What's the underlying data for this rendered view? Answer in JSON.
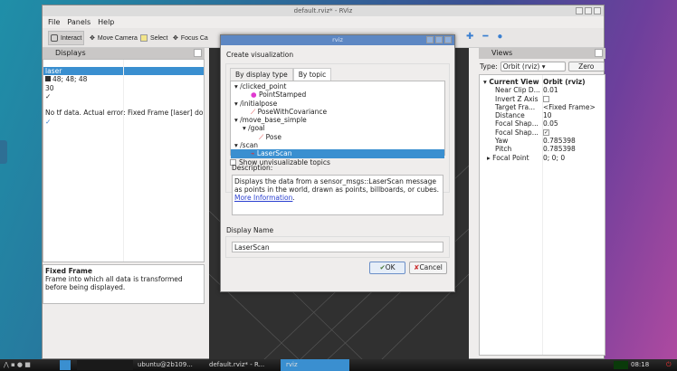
{
  "window": {
    "title": "default.rviz* - RViz"
  },
  "menu": [
    "File",
    "Panels",
    "Help"
  ],
  "toolbar": {
    "interact": "Interact",
    "move_camera": "Move Camera",
    "select": "Select",
    "focus_camera": "Focus Ca"
  },
  "displays": {
    "title": "Displays",
    "rows": [
      "laser",
      "48; 48; 48",
      "30",
      "✓",
      "",
      "No tf data.  Actual error: Fixed Frame [laser] does n",
      "✓"
    ],
    "help_title": "Fixed Frame",
    "help_text": "Frame into which all data is transformed before being displayed."
  },
  "dialog": {
    "title": "rviz",
    "heading": "Create visualization",
    "tabs": [
      "By display type",
      "By topic"
    ],
    "topics": [
      {
        "label": "/clicked_point",
        "indent": 0,
        "arrow": true
      },
      {
        "label": "PointStamped",
        "indent": 2,
        "icon": "point-icon"
      },
      {
        "label": "/initialpose",
        "indent": 0,
        "arrow": true
      },
      {
        "label": "PoseWithCovariance",
        "indent": 2,
        "icon": "pose-covariance-icon"
      },
      {
        "label": "/move_base_simple",
        "indent": 0,
        "arrow": true
      },
      {
        "label": "/goal",
        "indent": 1,
        "arrow": true
      },
      {
        "label": "Pose",
        "indent": 3,
        "icon": "pose-icon"
      },
      {
        "label": "/scan",
        "indent": 0,
        "arrow": true
      },
      {
        "label": "LaserScan",
        "indent": 2,
        "icon": "laserscan-icon",
        "selected": true
      }
    ],
    "show_unvisualizable": "Show unvisualizable topics",
    "description_label": "Description:",
    "description": "Displays the data from a sensor_msgs::LaserScan message as points in the world, drawn as points, billboards, or cubes. ",
    "more_info": "More Information",
    "display_name_label": "Display Name",
    "display_name": "LaserScan",
    "ok": "OK",
    "cancel": "Cancel"
  },
  "views": {
    "title": "Views",
    "type_label": "Type:",
    "type_value": "Orbit (rviz)",
    "zero": "Zero",
    "props": [
      [
        "Current View",
        "Orbit (rviz)"
      ],
      [
        "Near Clip D...",
        "0.01"
      ],
      [
        "Invert Z Axis",
        ""
      ],
      [
        "Target Fra...",
        "<Fixed Frame>"
      ],
      [
        "Distance",
        "10"
      ],
      [
        "Focal Shap...",
        "0.05"
      ],
      [
        "Focal Shap...",
        "✓"
      ],
      [
        "Yaw",
        "0.785398"
      ],
      [
        "Pitch",
        "0.785398"
      ],
      [
        "Focal Point",
        "0; 0; 0"
      ]
    ]
  },
  "taskbar": {
    "items": [
      "ubuntu@2b109...",
      "default.rviz* - R...",
      "rviz"
    ],
    "clock": "08:18"
  },
  "colors": {
    "accent": "#3a8fd0",
    "dialog_title": "#5d87c3"
  }
}
